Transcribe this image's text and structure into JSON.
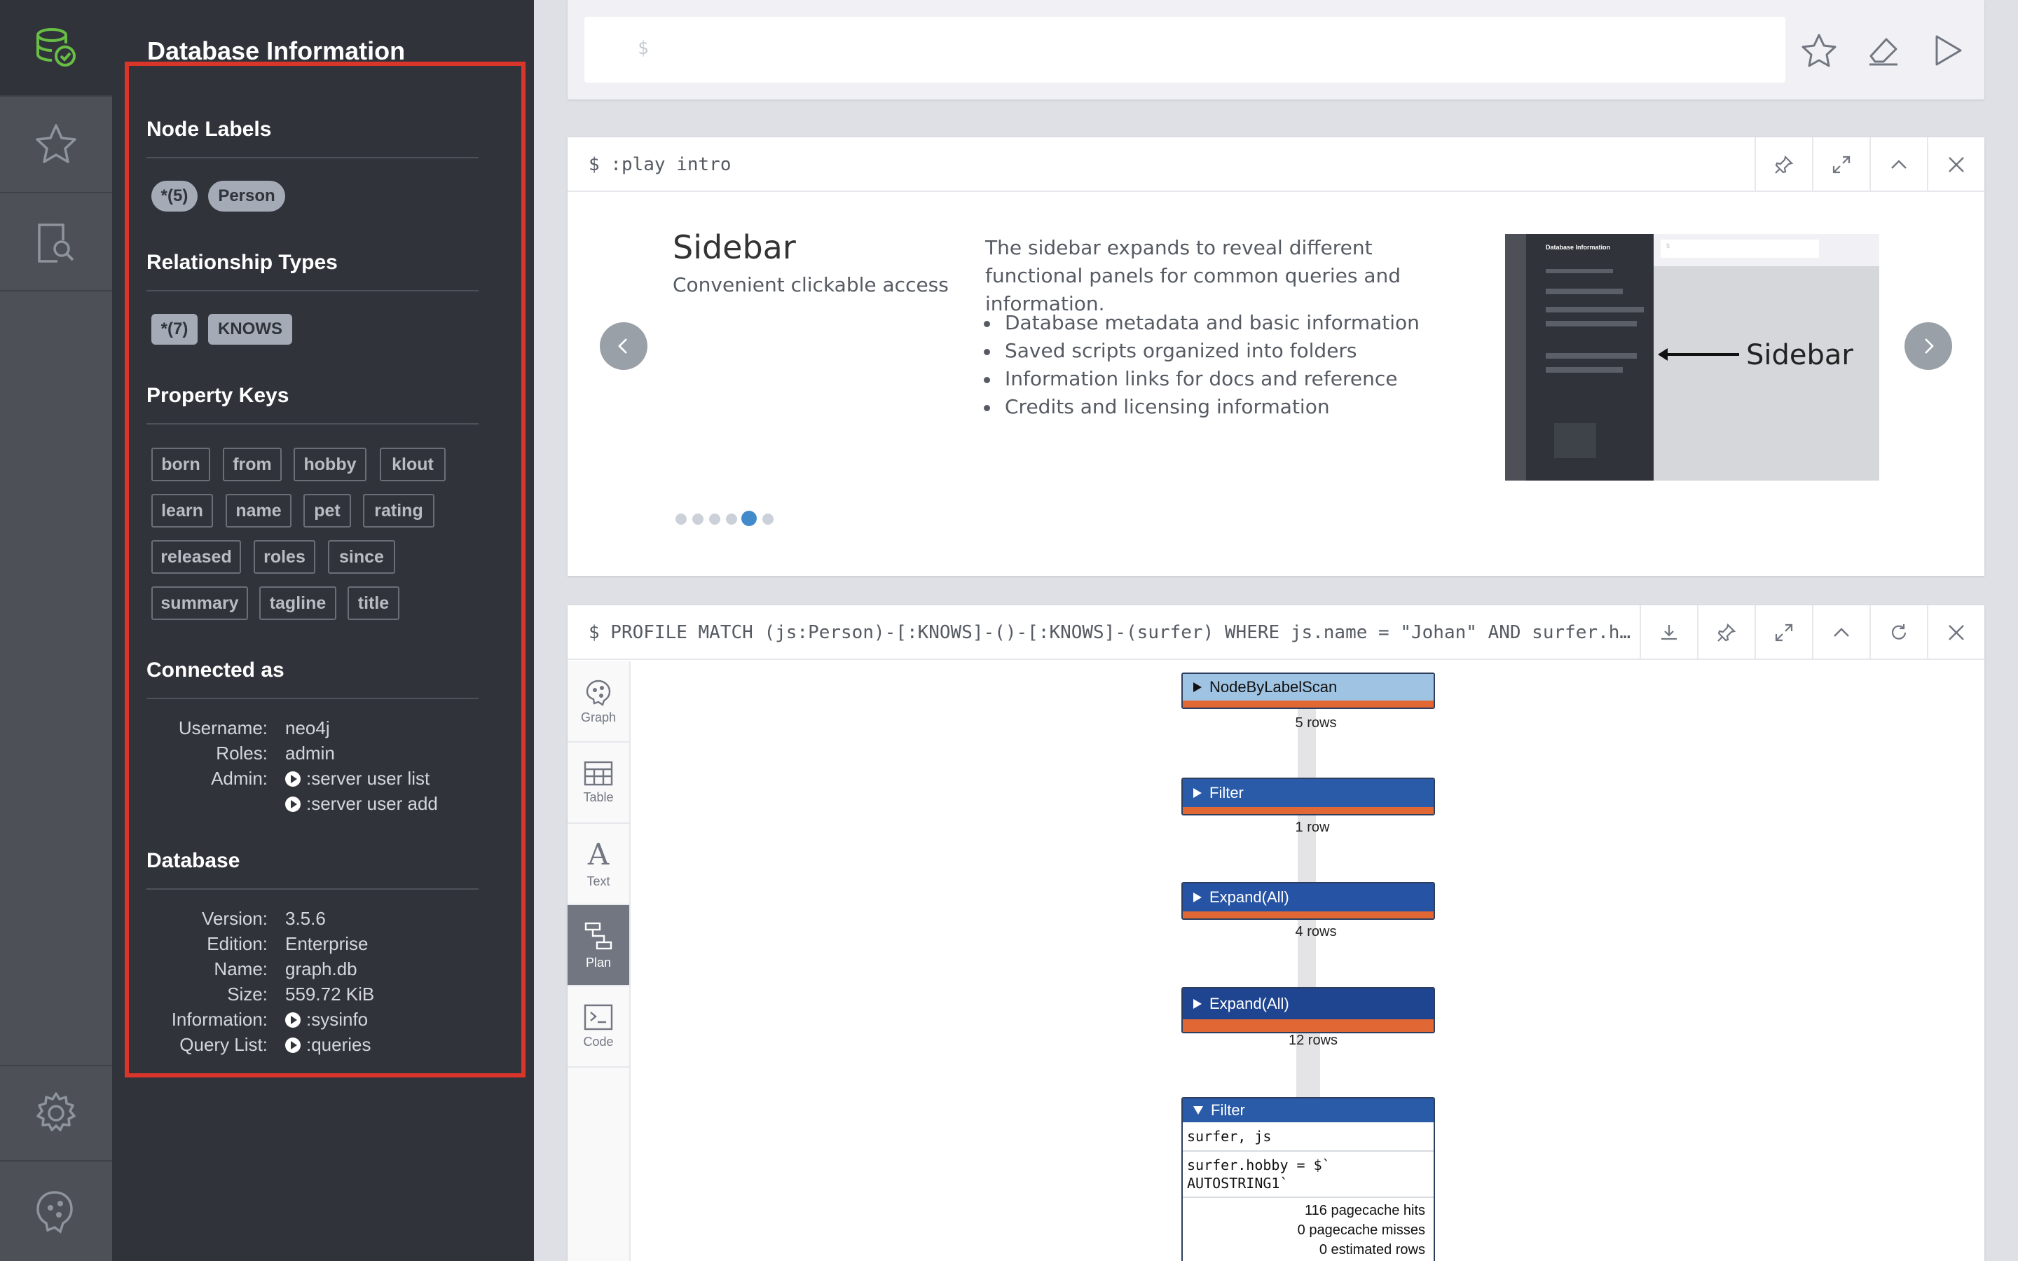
{
  "drawer": {
    "title": "Database Information",
    "node_labels": {
      "heading": "Node Labels",
      "items": [
        "*(5)",
        "Person"
      ]
    },
    "relationship_types": {
      "heading": "Relationship Types",
      "items": [
        "*(7)",
        "KNOWS"
      ]
    },
    "property_keys": {
      "heading": "Property Keys",
      "items": [
        "born",
        "from",
        "hobby",
        "klout",
        "learn",
        "name",
        "pet",
        "rating",
        "released",
        "roles",
        "since",
        "summary",
        "tagline",
        "title"
      ]
    },
    "connected_as": {
      "heading": "Connected as",
      "username_label": "Username:",
      "username": "neo4j",
      "roles_label": "Roles:",
      "roles": "admin",
      "admin_label": "Admin:",
      "admin_links": [
        ":server user list",
        ":server user add"
      ]
    },
    "database": {
      "heading": "Database",
      "version_label": "Version:",
      "version": "3.5.6",
      "edition_label": "Edition:",
      "edition": "Enterprise",
      "name_label": "Name:",
      "name": "graph.db",
      "size_label": "Size:",
      "size": "559.72 KiB",
      "information_label": "Information:",
      "information": ":sysinfo",
      "query_list_label": "Query List:",
      "query_list": ":queries"
    }
  },
  "editor": {
    "prompt": "$"
  },
  "intro_frame": {
    "command": "$ :play intro",
    "slide_title": "Sidebar",
    "slide_subtitle": "Convenient clickable access",
    "description": "The sidebar expands to reveal different functional panels for common queries and information.",
    "bullets": [
      "Database metadata and basic information",
      "Saved scripts organized into folders",
      "Information links for docs and reference",
      "Credits and licensing information"
    ],
    "image_caption": "Sidebar",
    "thumbnail": {
      "title": "Database Information",
      "prompt": "$"
    },
    "active_slide": 5,
    "slide_count": 6
  },
  "profile_frame": {
    "command": "$ PROFILE MATCH (js:Person)-[:KNOWS]-()-[:KNOWS]-(surfer) WHERE js.name = \"Johan\" AND surfer.h…",
    "tabs": [
      "Graph",
      "Table",
      "Text",
      "Plan",
      "Code"
    ],
    "active_tab": "Plan",
    "operators": [
      {
        "name": "NodeByLabelScan",
        "rows": "5 rows"
      },
      {
        "name": "Filter",
        "rows": "1 row"
      },
      {
        "name": "Expand(All)",
        "rows": "4 rows"
      },
      {
        "name": "Expand(All)",
        "rows": "12 rows"
      },
      {
        "name": "Filter",
        "identifiers": "surfer, js",
        "expression": "surfer.hobby = $`\nAUTOSTRING1`",
        "stats": [
          "116 pagecache hits",
          "0 pagecache misses",
          "0 estimated rows"
        ]
      }
    ]
  },
  "colors": {
    "nav": "#4d5157",
    "drawer": "#30333a",
    "highlight": "#d9352b",
    "operator_blue": "#2a5ba8",
    "operator_light": "#9fc3e2",
    "operator_accent": "#e16834"
  }
}
